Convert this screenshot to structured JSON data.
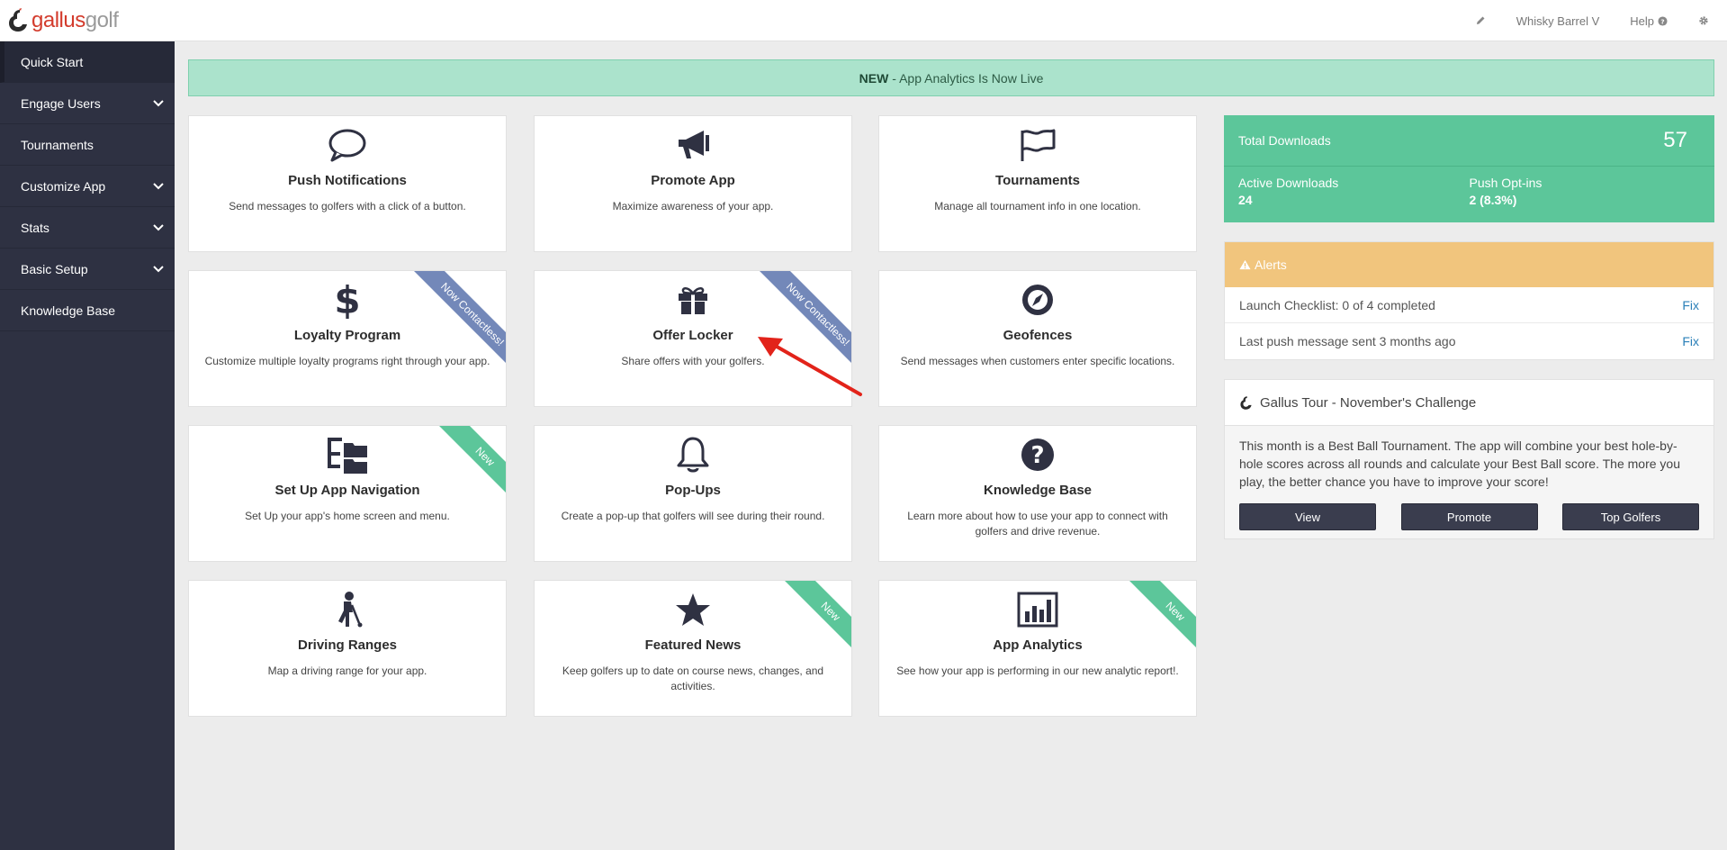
{
  "logo": {
    "gallus": "gallus",
    "golf": "golf"
  },
  "topnav": {
    "account": "Whisky Barrel V",
    "help": "Help"
  },
  "sidebar": {
    "items": [
      {
        "label": "Quick Start"
      },
      {
        "label": "Engage Users"
      },
      {
        "label": "Tournaments"
      },
      {
        "label": "Customize App"
      },
      {
        "label": "Stats"
      },
      {
        "label": "Basic Setup"
      },
      {
        "label": "Knowledge Base"
      }
    ]
  },
  "banner": {
    "bold": "NEW",
    "text": "- App Analytics Is Now Live"
  },
  "cards": [
    {
      "icon": "speech-bubble-icon",
      "title": "Push Notifications",
      "desc": "Send messages to golfers with a click of a button."
    },
    {
      "icon": "megaphone-icon",
      "title": "Promote App",
      "desc": "Maximize awareness of your app."
    },
    {
      "icon": "flag-icon",
      "title": "Tournaments",
      "desc": "Manage all tournament info in one location."
    },
    {
      "icon": "dollar-icon",
      "title": "Loyalty Program",
      "desc": "Customize multiple loyalty programs right through your app.",
      "ribbon": "Now Contactless!"
    },
    {
      "icon": "gift-icon",
      "title": "Offer Locker",
      "desc": "Share offers with your golfers.",
      "ribbon": "Now Contactless!"
    },
    {
      "icon": "compass-icon",
      "title": "Geofences",
      "desc": "Send messages when customers enter specific locations."
    },
    {
      "icon": "folder-tree-icon",
      "title": "Set Up App Navigation",
      "desc": "Set Up your app's home screen and menu.",
      "ribbon": "New"
    },
    {
      "icon": "bell-icon",
      "title": "Pop-Ups",
      "desc": "Create a pop-up that golfers will see during their round."
    },
    {
      "icon": "question-icon",
      "title": "Knowledge Base",
      "desc": "Learn more about how to use your app to connect with golfers and drive revenue."
    },
    {
      "icon": "golfer-icon",
      "title": "Driving Ranges",
      "desc": "Map a driving range for your app."
    },
    {
      "icon": "star-icon",
      "title": "Featured News",
      "desc": "Keep golfers up to date on course news, changes, and activities.",
      "ribbon": "New"
    },
    {
      "icon": "bar-chart-icon",
      "title": "App Analytics",
      "desc": "See how your app is performing in our new analytic report!.",
      "ribbon": "New"
    }
  ],
  "downloads": {
    "total_label": "Total Downloads",
    "total_value": "57",
    "active_label": "Active Downloads",
    "active_value": "24",
    "push_label": "Push Opt-ins",
    "push_value": "2 (8.3%)"
  },
  "alerts": {
    "title": "Alerts",
    "rows": [
      {
        "text": "Launch Checklist: 0 of 4 completed",
        "action": "Fix"
      },
      {
        "text": "Last push message sent 3 months ago",
        "action": "Fix"
      }
    ]
  },
  "tour": {
    "title": "Gallus Tour - November's Challenge",
    "body": "This month is a Best Ball Tournament. The app will combine your best hole-by-hole scores across all rounds and calculate your Best Ball score. The more you play, the better chance you have to improve your score!",
    "buttons": [
      "View",
      "Promote",
      "Top Golfers"
    ]
  },
  "colors": {
    "sidebar": "#2e3142",
    "accent_green": "#5cc69a",
    "alert_yellow": "#f1c57d",
    "ribbon_blue": "#7388b9",
    "arrow_red": "#e2231a"
  }
}
